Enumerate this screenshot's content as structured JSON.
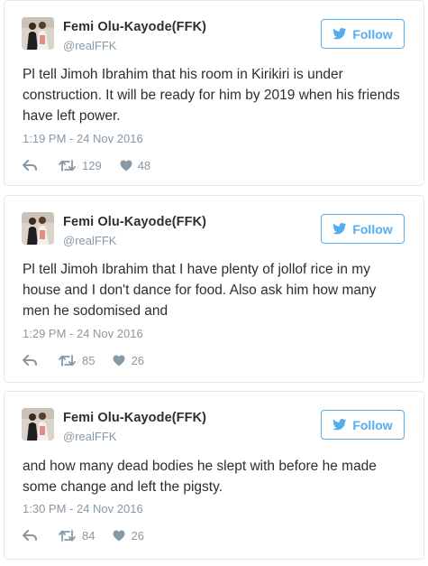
{
  "colors": {
    "accent": "#55acee",
    "muted": "#8899a6",
    "text": "#292f33",
    "border": "#e1e8ed"
  },
  "tweets": [
    {
      "name": "Femi Olu-Kayode(FFK)",
      "handle": "@realFFK",
      "follow_label": "Follow",
      "text": "Pl tell Jimoh Ibrahim that his room in Kirikiri is under construction. It will be ready for him by 2019 when his friends have left power.",
      "timestamp": "1:19 PM - 24 Nov 2016",
      "retweets": "129",
      "likes": "48"
    },
    {
      "name": "Femi Olu-Kayode(FFK)",
      "handle": "@realFFK",
      "follow_label": "Follow",
      "text": "Pl tell Jimoh Ibrahim that I have plenty of jollof rice in my house and I don't dance for food. Also ask him how many men he sodomised and",
      "timestamp": "1:29 PM - 24 Nov 2016",
      "retweets": "85",
      "likes": "26"
    },
    {
      "name": "Femi Olu-Kayode(FFK)",
      "handle": "@realFFK",
      "follow_label": "Follow",
      "text": "and how many dead bodies he slept with before he made some change and left the pigsty.",
      "timestamp": "1:30 PM - 24 Nov 2016",
      "retweets": "84",
      "likes": "26"
    }
  ]
}
